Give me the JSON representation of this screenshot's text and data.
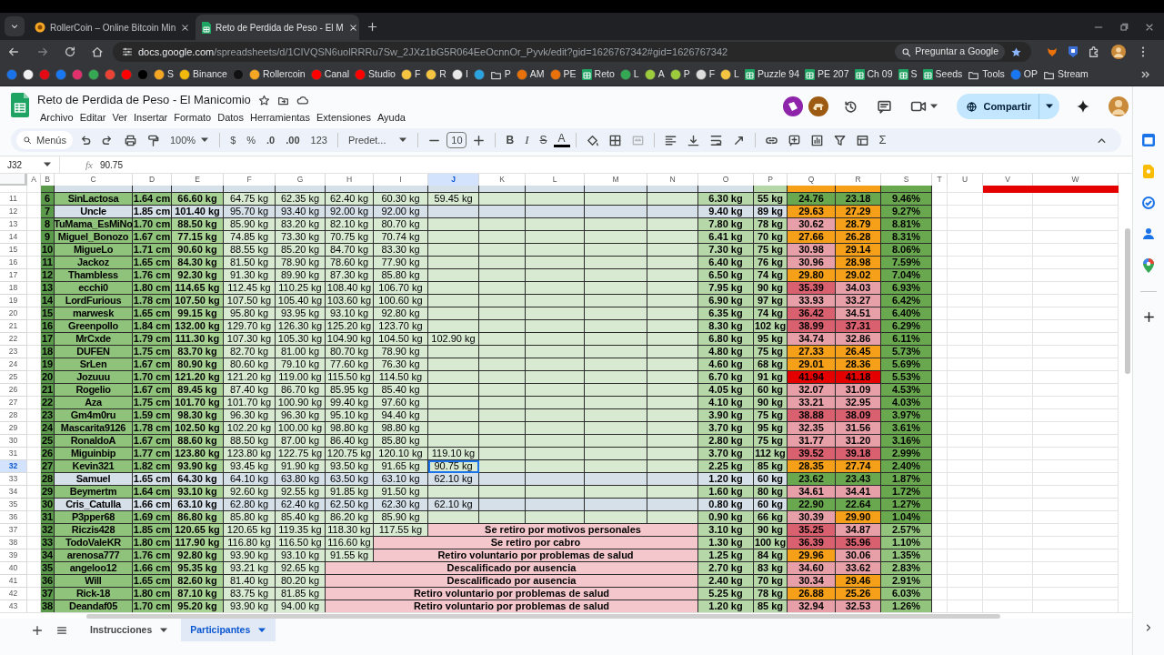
{
  "browser": {
    "tabs": [
      {
        "title": "RollerCoin – Online Bitcoin Min",
        "selected": false
      },
      {
        "title": "Reto de Perdida de Peso - El M",
        "selected": true
      }
    ],
    "url_host": "docs.google.com",
    "url_path": "/spreadsheets/d/1CIVQSN6uolRRRu7Sw_2JXz1bG5R064EeOcnnOr_Pyvk/edit?gid=1626767342#gid=1626767342",
    "ask_button": "Preguntar a Google",
    "bookmarks": [
      {
        "kind": "site",
        "color": "#1a73e8"
      },
      {
        "kind": "site",
        "color": "#f1f1f1"
      },
      {
        "kind": "site",
        "color": "#e50914"
      },
      {
        "kind": "site",
        "color": "#1877f2"
      },
      {
        "kind": "site",
        "color": "#e1306c"
      },
      {
        "kind": "site",
        "color": "#34a853"
      },
      {
        "kind": "site",
        "color": "#ea4335"
      },
      {
        "kind": "site",
        "color": "#ff0000"
      },
      {
        "kind": "site",
        "color": "#000000"
      },
      {
        "kind": "site",
        "color": "#f5a623",
        "label": "S"
      },
      {
        "kind": "site",
        "color": "#f0b90b",
        "label": "Binance"
      },
      {
        "kind": "site",
        "color": "#111111"
      },
      {
        "kind": "site",
        "color": "#f5a623",
        "label": "Rollercoin"
      },
      {
        "kind": "site",
        "color": "#ff0000",
        "label": "Canal"
      },
      {
        "kind": "site",
        "color": "#ff0000",
        "label": "Studio"
      },
      {
        "kind": "site",
        "color": "#f5c542",
        "label": "F"
      },
      {
        "kind": "site",
        "color": "#f5c542",
        "label": "R"
      },
      {
        "kind": "site",
        "color": "#e8e8e8",
        "label": "I"
      },
      {
        "kind": "site",
        "color": "#2aa3e0"
      },
      {
        "kind": "folder",
        "label": "P"
      },
      {
        "kind": "site",
        "color": "#e8710a",
        "label": "AM"
      },
      {
        "kind": "site",
        "color": "#e8710a",
        "label": "PE"
      },
      {
        "kind": "sheet",
        "label": "Reto"
      },
      {
        "kind": "site",
        "color": "#34a853",
        "label": "L"
      },
      {
        "kind": "site",
        "color": "#9ccc3c",
        "label": "A"
      },
      {
        "kind": "site",
        "color": "#9ccc3c",
        "label": "P"
      },
      {
        "kind": "site",
        "color": "#dddddd",
        "label": "F"
      },
      {
        "kind": "site",
        "color": "#f5c542",
        "label": "L"
      },
      {
        "kind": "sheet",
        "label": "Puzzle 94"
      },
      {
        "kind": "sheet",
        "label": "PE 207"
      },
      {
        "kind": "sheet",
        "label": "Ch 09"
      },
      {
        "kind": "sheet",
        "label": "S"
      },
      {
        "kind": "sheet",
        "label": "Seeds"
      },
      {
        "kind": "folder",
        "label": "Tools"
      },
      {
        "kind": "site",
        "color": "#1877f2",
        "label": "OP"
      },
      {
        "kind": "folder",
        "label": "Stream"
      }
    ]
  },
  "document": {
    "title": "Reto de Perdida de Peso - El Manicomio",
    "menu": [
      "Archivo",
      "Editar",
      "Ver",
      "Insertar",
      "Formato",
      "Datos",
      "Herramientas",
      "Extensiones",
      "Ayuda"
    ],
    "share_button": "Compartir"
  },
  "toolbar": {
    "search": "Menús",
    "zoom": "100%",
    "currency": "$",
    "percent": "%",
    "decrease_decimals": ".0",
    "increase_decimals": ".00",
    "number_format": "123",
    "font": "Predet...",
    "font_size": "10",
    "bold": "B",
    "italic": "I",
    "strikethrough": "S",
    "text_color": "A",
    "functions": "Σ"
  },
  "formula_bar": {
    "cell": "J32",
    "label": "fx",
    "value": "90.75"
  },
  "columns": [
    {
      "label": "A",
      "selected": false
    },
    {
      "label": "B",
      "selected": false
    },
    {
      "label": "C",
      "selected": false
    },
    {
      "label": "D",
      "selected": false
    },
    {
      "label": "E",
      "selected": false
    },
    {
      "label": "F",
      "selected": false
    },
    {
      "label": "G",
      "selected": false
    },
    {
      "label": "H",
      "selected": false
    },
    {
      "label": "I",
      "selected": false
    },
    {
      "label": "J",
      "selected": true
    },
    {
      "label": "K",
      "selected": false
    },
    {
      "label": "L",
      "selected": false
    },
    {
      "label": "M",
      "selected": false
    },
    {
      "label": "N",
      "selected": false
    },
    {
      "label": "O",
      "selected": false
    },
    {
      "label": "P",
      "selected": false
    },
    {
      "label": "Q",
      "selected": false
    },
    {
      "label": "R",
      "selected": false
    },
    {
      "label": "S",
      "selected": false
    },
    {
      "label": "T",
      "selected": false
    },
    {
      "label": "U",
      "selected": false
    },
    {
      "label": "V",
      "selected": false
    },
    {
      "label": "W",
      "selected": false
    }
  ],
  "rows": [
    {
      "row": "11",
      "b": "6",
      "c": "SinLactosa",
      "d": "1.64 cm",
      "weights": [
        "66.60 kg",
        "64.75 kg",
        "62.35 kg",
        "62.40 kg",
        "60.30 kg",
        "59.45 kg"
      ],
      "o": "6.30 kg",
      "p": "55 kg",
      "q": {
        "text": "24.76",
        "color": "#6aa84f"
      },
      "r": {
        "text": "23.18",
        "color": "#6aa84f"
      },
      "s": {
        "text": "9.46%",
        "color": "#6aa84f"
      },
      "highlighted": false,
      "selected": false
    },
    {
      "row": "12",
      "b": "7",
      "c": "Uncle",
      "d": "1.85 cm",
      "weights": [
        "101.40 kg",
        "95.70 kg",
        "93.40 kg",
        "92.00 kg",
        "92.00 kg"
      ],
      "o": "9.40 kg",
      "p": "89 kg",
      "q": {
        "text": "29.63",
        "color": "#f6a01a"
      },
      "r": {
        "text": "27.29",
        "color": "#f6a01a"
      },
      "s": {
        "text": "9.27%",
        "color": "#6aa84f"
      },
      "highlighted": true,
      "selected": false
    },
    {
      "row": "13",
      "b": "8",
      "c": "TuMama_EsMiNo",
      "d": "1.70 cm",
      "weights": [
        "88.50 kg",
        "85.90 kg",
        "83.20 kg",
        "82.10 kg",
        "80.70 kg"
      ],
      "o": "7.80 kg",
      "p": "78 kg",
      "q": {
        "text": "30.62",
        "color": "#e8a0a8"
      },
      "r": {
        "text": "28.79",
        "color": "#f6a01a"
      },
      "s": {
        "text": "8.81%",
        "color": "#6aa84f"
      },
      "highlighted": false,
      "selected": false
    },
    {
      "row": "14",
      "b": "9",
      "c": "Miguel_Bonozo",
      "d": "1.67 cm",
      "weights": [
        "77.15 kg",
        "74.85 kg",
        "73.30 kg",
        "70.75 kg",
        "70.74 kg"
      ],
      "o": "6.41 kg",
      "p": "70 kg",
      "q": {
        "text": "27.66",
        "color": "#f6a01a"
      },
      "r": {
        "text": "26.28",
        "color": "#f6a01a"
      },
      "s": {
        "text": "8.31%",
        "color": "#6aa84f"
      },
      "highlighted": false,
      "selected": false
    },
    {
      "row": "15",
      "b": "10",
      "c": "MigueLo",
      "d": "1.71 cm",
      "weights": [
        "90.60 kg",
        "88.55 kg",
        "85.20 kg",
        "84.70 kg",
        "83.30 kg"
      ],
      "o": "7.30 kg",
      "p": "75 kg",
      "q": {
        "text": "30.98",
        "color": "#e8a0a8"
      },
      "r": {
        "text": "29.14",
        "color": "#f6a01a"
      },
      "s": {
        "text": "8.06%",
        "color": "#6aa84f"
      },
      "highlighted": false,
      "selected": false
    },
    {
      "row": "16",
      "b": "11",
      "c": "Jackoz",
      "d": "1.65 cm",
      "weights": [
        "84.30 kg",
        "81.50 kg",
        "78.90 kg",
        "78.60 kg",
        "77.90 kg"
      ],
      "o": "6.40 kg",
      "p": "76 kg",
      "q": {
        "text": "30.96",
        "color": "#e8a0a8"
      },
      "r": {
        "text": "28.98",
        "color": "#f6a01a"
      },
      "s": {
        "text": "7.59%",
        "color": "#6aa84f"
      },
      "highlighted": false,
      "selected": false
    },
    {
      "row": "17",
      "b": "12",
      "c": "Thambless",
      "d": "1.76 cm",
      "weights": [
        "92.30 kg",
        "91.30 kg",
        "89.90 kg",
        "87.30 kg",
        "85.80 kg"
      ],
      "o": "6.50 kg",
      "p": "74 kg",
      "q": {
        "text": "29.80",
        "color": "#f6a01a"
      },
      "r": {
        "text": "29.02",
        "color": "#f6a01a"
      },
      "s": {
        "text": "7.04%",
        "color": "#6aa84f"
      },
      "highlighted": false,
      "selected": false
    },
    {
      "row": "18",
      "b": "13",
      "c": "ecchi0",
      "d": "1.80 cm",
      "weights": [
        "114.65 kg",
        "112.45 kg",
        "110.25 kg",
        "108.40 kg",
        "106.70 kg"
      ],
      "o": "7.95 kg",
      "p": "90 kg",
      "q": {
        "text": "35.39",
        "color": "#d9606e"
      },
      "r": {
        "text": "34.03",
        "color": "#e8a0a8"
      },
      "s": {
        "text": "6.93%",
        "color": "#6aa84f"
      },
      "highlighted": false,
      "selected": false
    },
    {
      "row": "19",
      "b": "14",
      "c": "LordFurious",
      "d": "1.78 cm",
      "weights": [
        "107.50 kg",
        "107.50 kg",
        "105.40 kg",
        "103.60 kg",
        "100.60 kg"
      ],
      "o": "6.90 kg",
      "p": "97 kg",
      "q": {
        "text": "33.93",
        "color": "#e8a0a8"
      },
      "r": {
        "text": "33.27",
        "color": "#e8a0a8"
      },
      "s": {
        "text": "6.42%",
        "color": "#6aa84f"
      },
      "highlighted": false,
      "selected": false
    },
    {
      "row": "20",
      "b": "15",
      "c": "marwesk",
      "d": "1.65 cm",
      "weights": [
        "99.15 kg",
        "95.80 kg",
        "93.95 kg",
        "93.10 kg",
        "92.80 kg"
      ],
      "o": "6.35 kg",
      "p": "74 kg",
      "q": {
        "text": "36.42",
        "color": "#d9606e"
      },
      "r": {
        "text": "34.51",
        "color": "#e8a0a8"
      },
      "s": {
        "text": "6.40%",
        "color": "#6aa84f"
      },
      "highlighted": false,
      "selected": false
    },
    {
      "row": "21",
      "b": "16",
      "c": "Greenpollo",
      "d": "1.84 cm",
      "weights": [
        "132.00 kg",
        "129.70 kg",
        "126.30 kg",
        "125.20 kg",
        "123.70 kg"
      ],
      "o": "8.30 kg",
      "p": "102 kg",
      "q": {
        "text": "38.99",
        "color": "#d9606e"
      },
      "r": {
        "text": "37.31",
        "color": "#d9606e"
      },
      "s": {
        "text": "6.29%",
        "color": "#6aa84f"
      },
      "highlighted": false,
      "selected": false
    },
    {
      "row": "22",
      "b": "17",
      "c": "MrCxde",
      "d": "1.79 cm",
      "weights": [
        "111.30 kg",
        "107.30 kg",
        "105.30 kg",
        "104.90 kg",
        "104.50 kg",
        "102.90 kg"
      ],
      "o": "6.80 kg",
      "p": "95 kg",
      "q": {
        "text": "34.74",
        "color": "#e8a0a8"
      },
      "r": {
        "text": "32.86",
        "color": "#e8a0a8"
      },
      "s": {
        "text": "6.11%",
        "color": "#6aa84f"
      },
      "highlighted": false,
      "selected": false
    },
    {
      "row": "23",
      "b": "18",
      "c": "DUFEN",
      "d": "1.75 cm",
      "weights": [
        "83.70 kg",
        "82.70 kg",
        "81.00 kg",
        "80.70 kg",
        "78.90 kg"
      ],
      "o": "4.80 kg",
      "p": "75 kg",
      "q": {
        "text": "27.33",
        "color": "#f6a01a"
      },
      "r": {
        "text": "26.45",
        "color": "#f6a01a"
      },
      "s": {
        "text": "5.73%",
        "color": "#6aa84f"
      },
      "highlighted": false,
      "selected": false
    },
    {
      "row": "24",
      "b": "19",
      "c": "SrLen",
      "d": "1.67 cm",
      "weights": [
        "80.90 kg",
        "80.60 kg",
        "79.10 kg",
        "77.60 kg",
        "76.30 kg"
      ],
      "o": "4.60 kg",
      "p": "68 kg",
      "q": {
        "text": "29.01",
        "color": "#f6a01a"
      },
      "r": {
        "text": "28.36",
        "color": "#f6a01a"
      },
      "s": {
        "text": "5.69%",
        "color": "#6aa84f"
      },
      "highlighted": false,
      "selected": false
    },
    {
      "row": "25",
      "b": "20",
      "c": "Jozuuu",
      "d": "1.70 cm",
      "weights": [
        "121.20 kg",
        "121.20 kg",
        "119.00 kg",
        "115.50 kg",
        "114.50 kg"
      ],
      "o": "6.70 kg",
      "p": "91 kg",
      "q": {
        "text": "41.94",
        "color": "#e50000"
      },
      "r": {
        "text": "41.18",
        "color": "#e50000"
      },
      "s": {
        "text": "5.53%",
        "color": "#6aa84f"
      },
      "highlighted": false,
      "selected": false
    },
    {
      "row": "26",
      "b": "21",
      "c": "Rogelio",
      "d": "1.67 cm",
      "weights": [
        "89.45 kg",
        "87.40 kg",
        "86.70 kg",
        "85.95 kg",
        "85.40 kg"
      ],
      "o": "4.05 kg",
      "p": "60 kg",
      "q": {
        "text": "32.07",
        "color": "#e8a0a8"
      },
      "r": {
        "text": "31.09",
        "color": "#e8a0a8"
      },
      "s": {
        "text": "4.53%",
        "color": "#6aa84f"
      },
      "highlighted": false,
      "selected": false
    },
    {
      "row": "27",
      "b": "22",
      "c": "Aza",
      "d": "1.75 cm",
      "weights": [
        "101.70 kg",
        "101.70 kg",
        "100.90 kg",
        "99.40 kg",
        "97.60 kg"
      ],
      "o": "4.10 kg",
      "p": "90 kg",
      "q": {
        "text": "33.21",
        "color": "#e8a0a8"
      },
      "r": {
        "text": "32.95",
        "color": "#e8a0a8"
      },
      "s": {
        "text": "4.03%",
        "color": "#6aa84f"
      },
      "highlighted": false,
      "selected": false
    },
    {
      "row": "28",
      "b": "23",
      "c": "Gm4m0ru",
      "d": "1.59 cm",
      "weights": [
        "98.30 kg",
        "96.30 kg",
        "96.30 kg",
        "95.10 kg",
        "94.40 kg"
      ],
      "o": "3.90 kg",
      "p": "75 kg",
      "q": {
        "text": "38.88",
        "color": "#d9606e"
      },
      "r": {
        "text": "38.09",
        "color": "#d9606e"
      },
      "s": {
        "text": "3.97%",
        "color": "#6aa84f"
      },
      "highlighted": false,
      "selected": false
    },
    {
      "row": "29",
      "b": "24",
      "c": "Mascarita9126",
      "d": "1.78 cm",
      "weights": [
        "102.50 kg",
        "102.20 kg",
        "100.00 kg",
        "98.80 kg",
        "98.80 kg"
      ],
      "o": "3.70 kg",
      "p": "95 kg",
      "q": {
        "text": "32.35",
        "color": "#e8a0a8"
      },
      "r": {
        "text": "31.56",
        "color": "#e8a0a8"
      },
      "s": {
        "text": "3.61%",
        "color": "#6aa84f"
      },
      "highlighted": false,
      "selected": false
    },
    {
      "row": "30",
      "b": "25",
      "c": "RonaldoA",
      "d": "1.67 cm",
      "weights": [
        "88.60 kg",
        "88.50 kg",
        "87.00 kg",
        "86.40 kg",
        "85.80 kg"
      ],
      "o": "2.80 kg",
      "p": "75 kg",
      "q": {
        "text": "31.77",
        "color": "#e8a0a8"
      },
      "r": {
        "text": "31.20",
        "color": "#e8a0a8"
      },
      "s": {
        "text": "3.16%",
        "color": "#6aa84f"
      },
      "highlighted": false,
      "selected": false
    },
    {
      "row": "31",
      "b": "26",
      "c": "Miguinbip",
      "d": "1.77 cm",
      "weights": [
        "123.80 kg",
        "123.80 kg",
        "122.75 kg",
        "120.75 kg",
        "120.10 kg",
        "119.10 kg"
      ],
      "o": "3.70 kg",
      "p": "112 kg",
      "q": {
        "text": "39.52",
        "color": "#d9606e"
      },
      "r": {
        "text": "39.18",
        "color": "#d9606e"
      },
      "s": {
        "text": "2.99%",
        "color": "#6aa84f"
      },
      "highlighted": false,
      "selected": false
    },
    {
      "row": "32",
      "b": "27",
      "c": "Kevin321",
      "d": "1.82 cm",
      "weights": [
        "93.90 kg",
        "93.45 kg",
        "91.90 kg",
        "93.50 kg",
        "91.65 kg",
        "90.75 kg"
      ],
      "o": "2.25 kg",
      "p": "85 kg",
      "q": {
        "text": "28.35",
        "color": "#f6a01a"
      },
      "r": {
        "text": "27.74",
        "color": "#f6a01a"
      },
      "s": {
        "text": "2.40%",
        "color": "#6aa84f"
      },
      "highlighted": false,
      "selected": true
    },
    {
      "row": "33",
      "b": "28",
      "c": "Samuel",
      "d": "1.65 cm",
      "weights": [
        "64.30 kg",
        "64.10 kg",
        "63.80 kg",
        "63.50 kg",
        "63.10 kg",
        "62.10 kg"
      ],
      "o": "1.20 kg",
      "p": "60 kg",
      "q": {
        "text": "23.62",
        "color": "#6aa84f"
      },
      "r": {
        "text": "23.43",
        "color": "#6aa84f"
      },
      "s": {
        "text": "1.87%",
        "color": "#6aa84f"
      },
      "highlighted": true,
      "selected": false
    },
    {
      "row": "34",
      "b": "29",
      "c": "Beymertm",
      "d": "1.64 cm",
      "weights": [
        "93.10 kg",
        "92.60 kg",
        "92.55 kg",
        "91.85 kg",
        "91.50 kg"
      ],
      "o": "1.60 kg",
      "p": "80 kg",
      "q": {
        "text": "34.61",
        "color": "#e8a0a8"
      },
      "r": {
        "text": "34.41",
        "color": "#e8a0a8"
      },
      "s": {
        "text": "1.72%",
        "color": "#6aa84f"
      },
      "highlighted": false,
      "selected": false
    },
    {
      "row": "35",
      "b": "30",
      "c": "Cris_Catulla",
      "d": "1.66 cm",
      "weights": [
        "63.10 kg",
        "62.80 kg",
        "62.40 kg",
        "62.50 kg",
        "62.30 kg",
        "62.10 kg"
      ],
      "o": "0.80 kg",
      "p": "60 kg",
      "q": {
        "text": "22.90",
        "color": "#6aa84f"
      },
      "r": {
        "text": "22.64",
        "color": "#6aa84f"
      },
      "s": {
        "text": "1.27%",
        "color": "#6aa84f"
      },
      "highlighted": true,
      "selected": false
    },
    {
      "row": "36",
      "b": "31",
      "c": "P3pper68",
      "d": "1.69 cm",
      "weights": [
        "86.80 kg",
        "85.80 kg",
        "85.40 kg",
        "86.20 kg",
        "85.90 kg"
      ],
      "o": "0.90 kg",
      "p": "66 kg",
      "q": {
        "text": "30.39",
        "color": "#e8a0a8"
      },
      "r": {
        "text": "29.90",
        "color": "#f6a01a"
      },
      "s": {
        "text": "1.04%",
        "color": "#6aa84f"
      },
      "highlighted": false,
      "selected": false
    },
    {
      "row": "37",
      "b": "32",
      "c": "Riczis428",
      "d": "1.85 cm",
      "weights": [
        "120.65 kg",
        "120.65 kg",
        "119.35 kg",
        "118.30 kg",
        "117.55 kg"
      ],
      "status": "Se retiro por motivos personales",
      "o": "3.10 kg",
      "p": "90 kg",
      "q": {
        "text": "35.25",
        "color": "#d9606e"
      },
      "r": {
        "text": "34.87",
        "color": "#e8a0a8"
      },
      "s": {
        "text": "2.57%",
        "color": "#93c47d"
      },
      "highlighted": false,
      "selected": false
    },
    {
      "row": "38",
      "b": "33",
      "c": "TodoValeKR",
      "d": "1.80 cm",
      "weights": [
        "117.90 kg",
        "116.80 kg",
        "116.50 kg",
        "116.60 kg"
      ],
      "status": "Se retiro por cabro",
      "o": "1.30 kg",
      "p": "100 kg",
      "q": {
        "text": "36.39",
        "color": "#d9606e"
      },
      "r": {
        "text": "35.96",
        "color": "#d9606e"
      },
      "s": {
        "text": "1.10%",
        "color": "#93c47d"
      },
      "highlighted": false,
      "selected": false
    },
    {
      "row": "39",
      "b": "34",
      "c": "arenosa777",
      "d": "1.76 cm",
      "weights": [
        "92.80 kg",
        "93.90 kg",
        "93.10 kg",
        "91.55 kg"
      ],
      "status": "Retiro voluntario por problemas de salud",
      "o": "1.25 kg",
      "p": "84 kg",
      "q": {
        "text": "29.96",
        "color": "#f6a01a"
      },
      "r": {
        "text": "30.06",
        "color": "#e8a0a8"
      },
      "s": {
        "text": "1.35%",
        "color": "#93c47d"
      },
      "highlighted": false,
      "selected": false
    },
    {
      "row": "40",
      "b": "35",
      "c": "angeloo12",
      "d": "1.66 cm",
      "weights": [
        "95.35 kg",
        "93.21 kg",
        "92.65 kg"
      ],
      "status": "Descalificado por ausencia",
      "o": "2.70 kg",
      "p": "83 kg",
      "q": {
        "text": "34.60",
        "color": "#e8a0a8"
      },
      "r": {
        "text": "33.62",
        "color": "#e8a0a8"
      },
      "s": {
        "text": "2.83%",
        "color": "#93c47d"
      },
      "highlighted": false,
      "selected": false
    },
    {
      "row": "41",
      "b": "36",
      "c": "Will",
      "d": "1.65 cm",
      "weights": [
        "82.60 kg",
        "81.40 kg",
        "80.20 kg"
      ],
      "status": "Descalificado por ausencia",
      "o": "2.40 kg",
      "p": "70 kg",
      "q": {
        "text": "30.34",
        "color": "#e8a0a8"
      },
      "r": {
        "text": "29.46",
        "color": "#f6a01a"
      },
      "s": {
        "text": "2.91%",
        "color": "#93c47d"
      },
      "highlighted": false,
      "selected": false
    },
    {
      "row": "42",
      "b": "37",
      "c": "Rick-18",
      "d": "1.80 cm",
      "weights": [
        "87.10 kg",
        "83.75 kg",
        "81.85 kg"
      ],
      "status": "Retiro voluntario por problemas de salud",
      "o": "5.25 kg",
      "p": "78 kg",
      "q": {
        "text": "26.88",
        "color": "#f6a01a"
      },
      "r": {
        "text": "25.26",
        "color": "#f6a01a"
      },
      "s": {
        "text": "6.03%",
        "color": "#93c47d"
      },
      "highlighted": false,
      "selected": false
    },
    {
      "row": "43",
      "b": "38",
      "c": "Deandaf05",
      "d": "1.70 cm",
      "weights": [
        "95.20 kg",
        "93.90 kg",
        "94.00 kg"
      ],
      "status": "Retiro voluntario por problemas de salud",
      "o": "1.20 kg",
      "p": "85 kg",
      "q": {
        "text": "32.94",
        "color": "#e8a0a8"
      },
      "r": {
        "text": "32.53",
        "color": "#e8a0a8"
      },
      "s": {
        "text": "1.26%",
        "color": "#93c47d"
      },
      "highlighted": false,
      "selected": false
    }
  ],
  "sheet_tabs": [
    {
      "label": "Instrucciones",
      "selected": false
    },
    {
      "label": "Participantes",
      "selected": true
    }
  ]
}
